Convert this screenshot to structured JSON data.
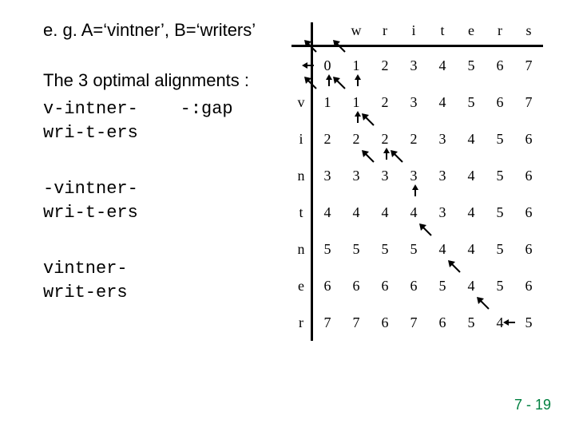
{
  "heading": "e. g. A=‘vintner’, B=‘writers’",
  "intro": "The 3 optimal alignments :",
  "align1_a": "v-intner-    -:gap",
  "align1_b": "wri-t-ers",
  "align2_a": "-vintner-",
  "align2_b": "wri-t-ers",
  "align3_a": "vintner-",
  "align3_b": "writ-ers",
  "page_num": "7 - 19",
  "chart_data": {
    "type": "table",
    "title": "edit distance DP table with traceback arrows",
    "col_headers": [
      "",
      "w",
      "r",
      "i",
      "t",
      "e",
      "r",
      "s"
    ],
    "row_headers": [
      "",
      "v",
      "i",
      "n",
      "t",
      "n",
      "e",
      "r"
    ],
    "values": [
      [
        0,
        1,
        2,
        3,
        4,
        5,
        6,
        7
      ],
      [
        1,
        1,
        2,
        3,
        4,
        5,
        6,
        7
      ],
      [
        2,
        2,
        2,
        2,
        3,
        4,
        5,
        6
      ],
      [
        3,
        3,
        3,
        3,
        3,
        4,
        5,
        6
      ],
      [
        4,
        4,
        4,
        4,
        3,
        4,
        5,
        6
      ],
      [
        5,
        5,
        5,
        5,
        4,
        4,
        5,
        6
      ],
      [
        6,
        6,
        6,
        6,
        5,
        4,
        5,
        6
      ],
      [
        7,
        7,
        6,
        7,
        6,
        5,
        4,
        5
      ]
    ],
    "arrows": [
      {
        "r": 0,
        "c": 0,
        "d": "left"
      },
      {
        "r": 0,
        "c": 0,
        "d": "diag"
      },
      {
        "r": 0,
        "c": 1,
        "d": "diag"
      },
      {
        "r": 1,
        "c": 0,
        "d": "diag"
      },
      {
        "r": 1,
        "c": 0,
        "d": "up"
      },
      {
        "r": 1,
        "c": 1,
        "d": "diag"
      },
      {
        "r": 1,
        "c": 1,
        "d": "up"
      },
      {
        "r": 2,
        "c": 1,
        "d": "up"
      },
      {
        "r": 2,
        "c": 2,
        "d": "diag"
      },
      {
        "r": 3,
        "c": 2,
        "d": "diag"
      },
      {
        "r": 3,
        "c": 2,
        "d": "up"
      },
      {
        "r": 3,
        "c": 3,
        "d": "diag"
      },
      {
        "r": 4,
        "c": 3,
        "d": "up"
      },
      {
        "r": 5,
        "c": 4,
        "d": "diag"
      },
      {
        "r": 6,
        "c": 5,
        "d": "diag"
      },
      {
        "r": 7,
        "c": 6,
        "d": "diag"
      },
      {
        "r": 7,
        "c": 7,
        "d": "left"
      }
    ]
  }
}
